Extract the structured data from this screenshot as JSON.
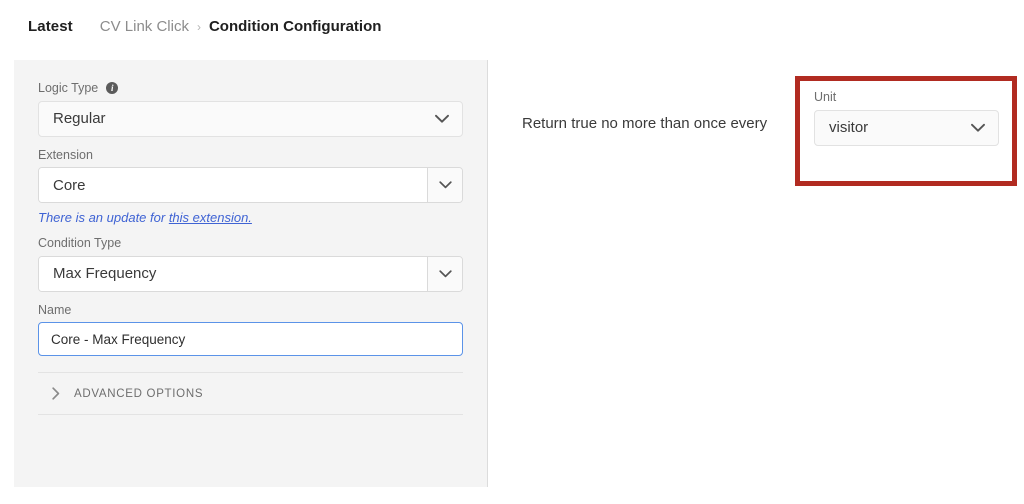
{
  "breadcrumb": {
    "latest": "Latest",
    "parent": "CV Link Click",
    "separator": "›",
    "current": "Condition Configuration"
  },
  "left_panel": {
    "logic_type": {
      "label": "Logic Type",
      "info_icon": "info-icon",
      "info_glyph": "i",
      "value": "Regular"
    },
    "extension": {
      "label": "Extension",
      "value": "Core"
    },
    "update_note": {
      "text": "There is an update for ",
      "link_text": "this extension."
    },
    "condition_type": {
      "label": "Condition Type",
      "value": "Max Frequency"
    },
    "name": {
      "label": "Name",
      "value": "Core - Max Frequency",
      "placeholder": "Name"
    },
    "advanced_options": {
      "label": "ADVANCED OPTIONS",
      "chevron_icon": "chevron-right-icon"
    }
  },
  "right_panel": {
    "sentence": "Return true no more than once every",
    "unit": {
      "label": "Unit",
      "value": "visitor",
      "chevron_icon": "chevron-down-icon"
    },
    "highlight_color": "#b12b21"
  },
  "colors": {
    "panel_background": "#f4f4f4",
    "link_blue": "#3f63d4",
    "focus_blue": "#5b93e8",
    "highlight_red": "#b12b21"
  }
}
